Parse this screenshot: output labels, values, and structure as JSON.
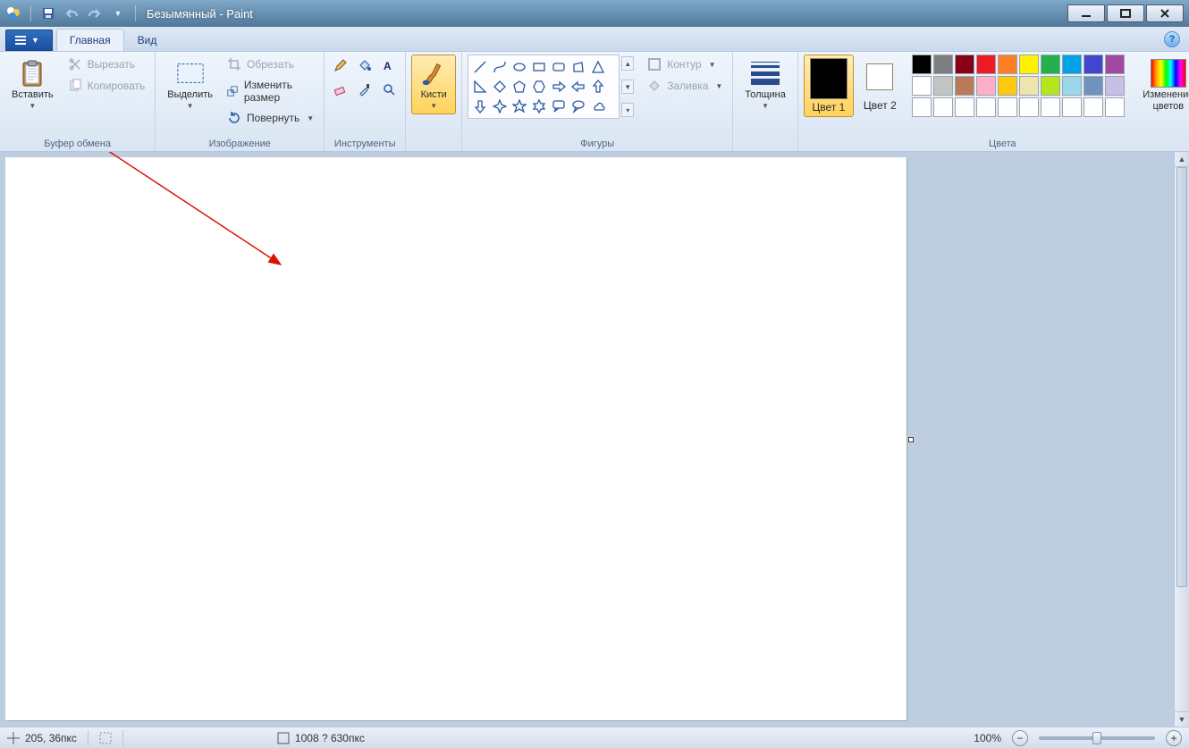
{
  "title": "Безымянный - Paint",
  "tabs": {
    "home": "Главная",
    "view": "Вид"
  },
  "file_menu": {
    "aria": "Файл"
  },
  "groups": {
    "clipboard": {
      "label": "Буфер обмена",
      "paste": "Вставить",
      "cut": "Вырезать",
      "copy": "Копировать"
    },
    "image": {
      "label": "Изображение",
      "select": "Выделить",
      "crop": "Обрезать",
      "resize": "Изменить размер",
      "rotate": "Повернуть"
    },
    "tools": {
      "label": "Инструменты"
    },
    "brushes": {
      "label": "Кисти"
    },
    "shapes": {
      "label": "Фигуры",
      "outline": "Контур",
      "fill": "Заливка"
    },
    "thickness": {
      "label": "Толщина"
    },
    "colors": {
      "label": "Цвета",
      "c1": "Цвет 1",
      "c2": "Цвет 2",
      "edit": "Изменение цветов"
    }
  },
  "palette_row1": [
    "#000000",
    "#7f7f7f",
    "#880015",
    "#ed1c24",
    "#ff7f27",
    "#fff200",
    "#22b14c",
    "#00a2e8",
    "#3f48cc",
    "#a349a4"
  ],
  "palette_row2": [
    "#ffffff",
    "#c3c3c3",
    "#b97a57",
    "#ffaec9",
    "#ffc90e",
    "#efe4b0",
    "#b5e61d",
    "#99d9ea",
    "#7092be",
    "#c8bfe7"
  ],
  "palette_row3": [
    "#ffffff",
    "#ffffff",
    "#ffffff",
    "#ffffff",
    "#ffffff",
    "#ffffff",
    "#ffffff",
    "#ffffff",
    "#ffffff",
    "#ffffff"
  ],
  "color1": "#000000",
  "color2": "#ffffff",
  "status": {
    "pos": "205, 36пкс",
    "size": "1008 ? 630пкс",
    "zoom": "100%"
  }
}
